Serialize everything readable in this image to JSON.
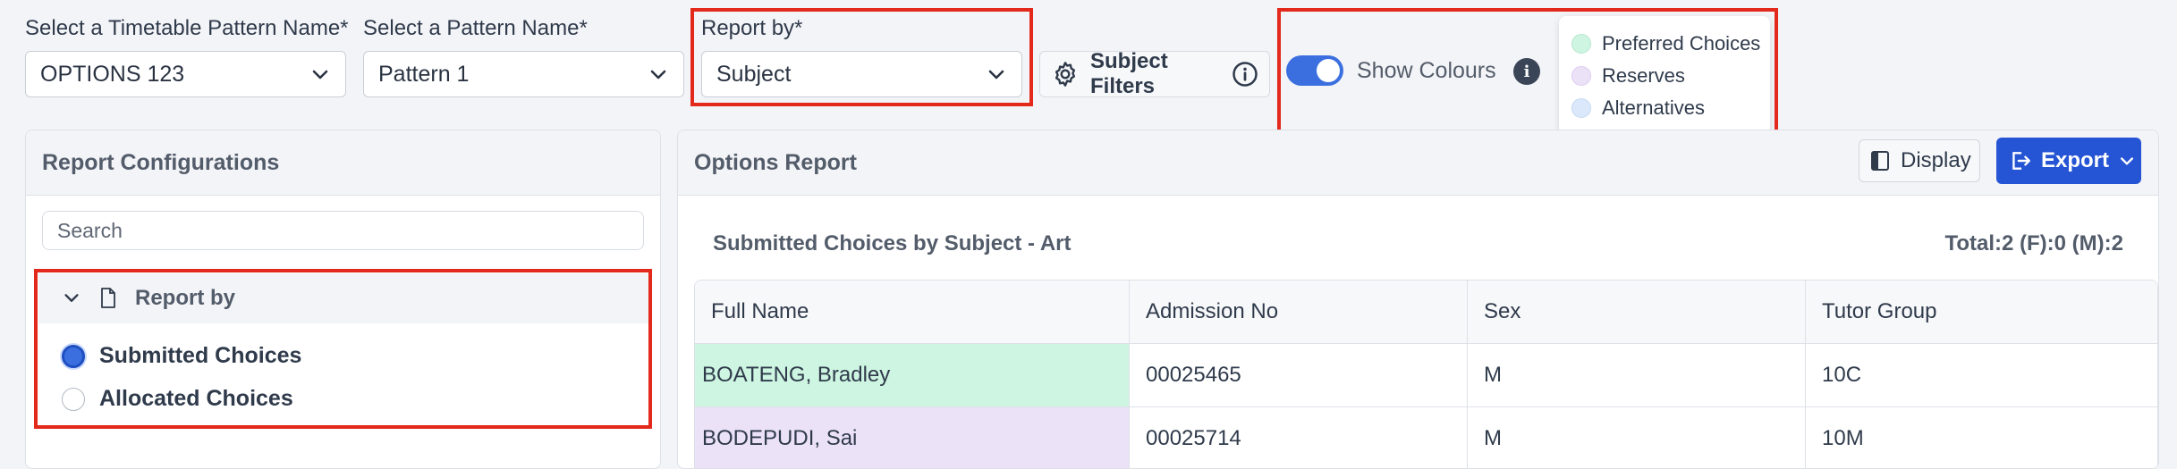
{
  "filters": {
    "timetable_label": "Select a Timetable Pattern Name*",
    "timetable_value": "OPTIONS 123",
    "pattern_label": "Select a Pattern Name*",
    "pattern_value": "Pattern 1",
    "report_by_label": "Report by*",
    "report_by_value": "Subject",
    "subject_filters_label": "Subject Filters"
  },
  "colours": {
    "toggle_label": "Show Colours",
    "toggle_on": true,
    "legend": [
      {
        "label": "Preferred Choices",
        "color": "#cdf5e1"
      },
      {
        "label": "Reserves",
        "color": "#ece2f8"
      },
      {
        "label": "Alternatives",
        "color": "#dbe8fb"
      }
    ]
  },
  "config": {
    "title": "Report Configurations",
    "search_placeholder": "Search",
    "section_title": "Report by",
    "options": [
      {
        "label": "Submitted Choices",
        "selected": true
      },
      {
        "label": "Allocated Choices",
        "selected": false
      }
    ]
  },
  "report": {
    "title": "Options Report",
    "display_label": "Display",
    "export_label": "Export",
    "subtitle": "Submitted Choices by Subject - Art",
    "total": "Total:2 (F):0 (M):2",
    "columns": [
      "Full Name",
      "Admission No",
      "Sex",
      "Tutor Group"
    ],
    "rows": [
      {
        "name": "BOATENG, Bradley",
        "adm": "00025465",
        "sex": "M",
        "tutor": "10C",
        "color": "#cdf5e1"
      },
      {
        "name": "BODEPUDI, Sai",
        "adm": "00025714",
        "sex": "M",
        "tutor": "10M",
        "color": "#ece2f8"
      }
    ]
  },
  "theme": {
    "accent": "#3b6fe0",
    "export_bg": "#2554d4",
    "highlight": "#e2291b"
  }
}
